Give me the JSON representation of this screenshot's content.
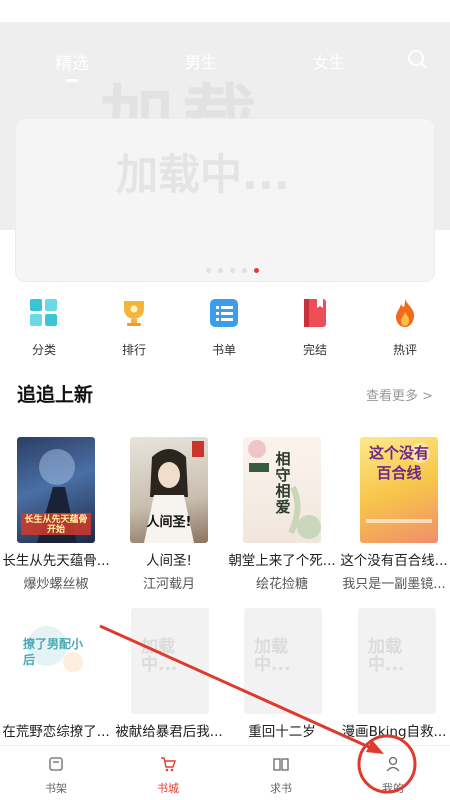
{
  "top_tabs": [
    "精选",
    "男生",
    "女生"
  ],
  "banner": {
    "watermark": "加载中...",
    "header_watermark": "加载"
  },
  "entries": [
    {
      "label": "分类",
      "icon": "grid-icon",
      "color": "#3bc4d6"
    },
    {
      "label": "排行",
      "icon": "trophy-icon",
      "color": "#f5b53a"
    },
    {
      "label": "书单",
      "icon": "list-icon",
      "color": "#3a9ef0"
    },
    {
      "label": "完结",
      "icon": "book-icon",
      "color": "#ec4d57"
    },
    {
      "label": "热评",
      "icon": "flame-icon",
      "color": "#f26a1b"
    }
  ],
  "section": {
    "title": "追追上新",
    "more": "查看更多 >"
  },
  "books_row1": [
    {
      "title": "长生从先天蕴骨...",
      "author": "爆炒螺丝椒",
      "cover_text": "长生从先天蕴骨开始"
    },
    {
      "title": "人间圣!",
      "author": "江河载月",
      "cover_text": "人间圣!"
    },
    {
      "title": "朝堂上来了个死...",
      "author": "绘花捡糖",
      "cover_text": "相守相爱"
    },
    {
      "title": "这个没有百合线...",
      "author": "我只是一副墨镜...",
      "cover_text": "这个没有百合线"
    }
  ],
  "books_row2": [
    {
      "title": "在荒野恋综撩了...",
      "cover_text": "撩了男配小后"
    },
    {
      "title": "被献给暴君后我...",
      "cover_text": "加载中..."
    },
    {
      "title": "重回十二岁",
      "cover_text": "加载中..."
    },
    {
      "title": "漫画Bking自救...",
      "cover_text": "加载中..."
    }
  ],
  "bottom_nav": [
    {
      "label": "书架",
      "icon": "bookshelf-icon"
    },
    {
      "label": "书城",
      "icon": "cart-icon"
    },
    {
      "label": "求书",
      "icon": "open-book-icon"
    },
    {
      "label": "我的",
      "icon": "user-icon"
    }
  ],
  "colors": {
    "accent": "#e83a30",
    "annotation": "#e03a2e"
  }
}
